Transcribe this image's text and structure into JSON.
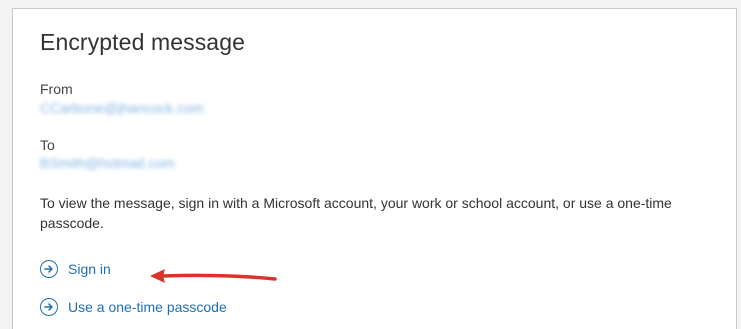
{
  "message": {
    "title": "Encrypted message",
    "from_label": "From",
    "from_value": "CCarbone@jhancock.com",
    "to_label": "To",
    "to_value": "BSmith@hotmail.com",
    "description": "To view the message, sign in with a Microsoft account, your work or school account, or use a one-time passcode."
  },
  "actions": {
    "sign_in": "Sign in",
    "one_time_passcode": "Use a one-time passcode"
  },
  "colors": {
    "link": "#1f6fb5",
    "annotation_arrow": "#d9332b"
  },
  "icons": {
    "action": "arrow-right-circle-icon",
    "annotation": "annotation-arrow-icon"
  }
}
